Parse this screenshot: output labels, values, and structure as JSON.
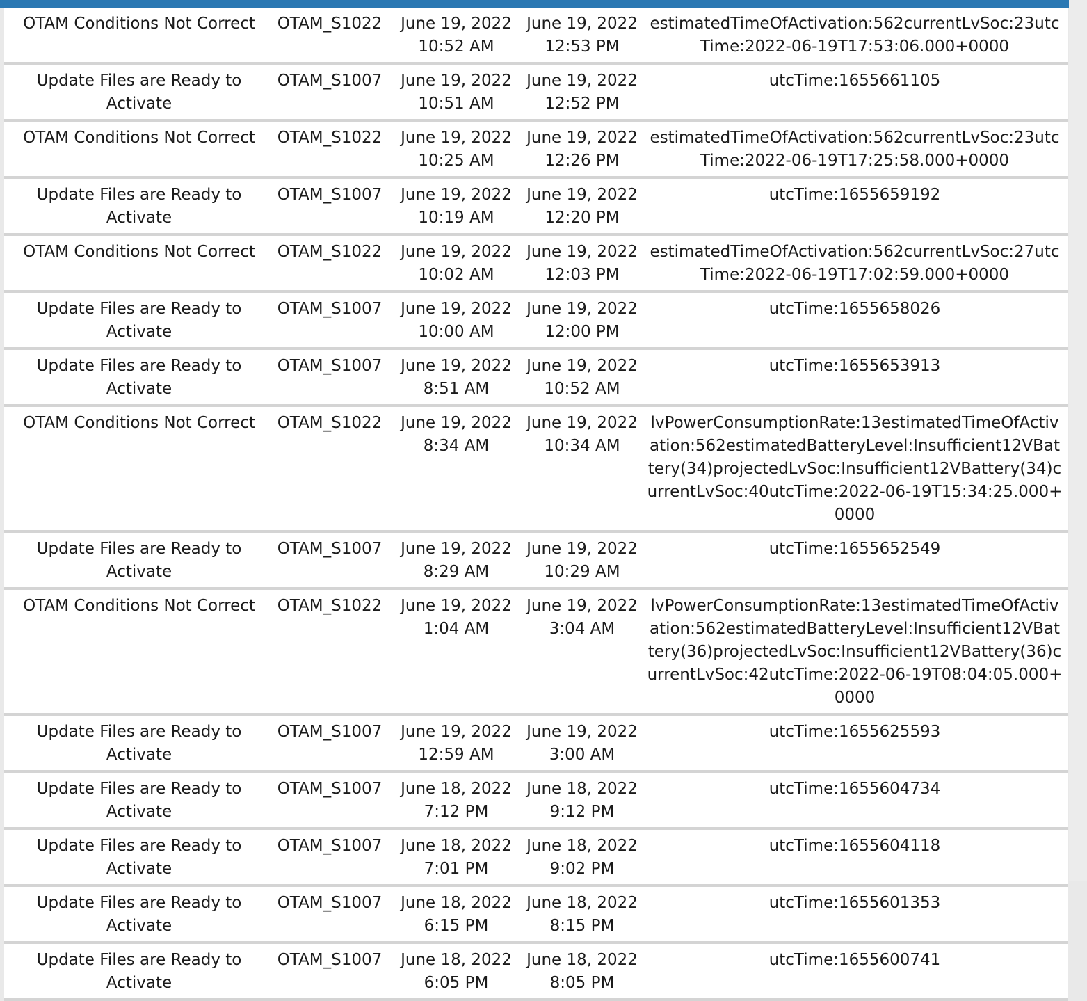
{
  "table": {
    "rows": [
      {
        "name": "OTAM Conditions Not Correct",
        "code": "OTAM_S1022",
        "start_date": "June 19, 2022",
        "start_time": "10:52 AM",
        "end_date": "June 19, 2022",
        "end_time": "12:53 PM",
        "data": "estimatedTimeOfActivation:562currentLvSoc:23utcTime:2022-06-19T17:53:06.000+0000"
      },
      {
        "name": "Update Files are Ready to Activate",
        "code": "OTAM_S1007",
        "start_date": "June 19, 2022",
        "start_time": "10:51 AM",
        "end_date": "June 19, 2022",
        "end_time": "12:52 PM",
        "data": "utcTime:1655661105"
      },
      {
        "name": "OTAM Conditions Not Correct",
        "code": "OTAM_S1022",
        "start_date": "June 19, 2022",
        "start_time": "10:25 AM",
        "end_date": "June 19, 2022",
        "end_time": "12:26 PM",
        "data": "estimatedTimeOfActivation:562currentLvSoc:23utcTime:2022-06-19T17:25:58.000+0000"
      },
      {
        "name": "Update Files are Ready to Activate",
        "code": "OTAM_S1007",
        "start_date": "June 19, 2022",
        "start_time": "10:19 AM",
        "end_date": "June 19, 2022",
        "end_time": "12:20 PM",
        "data": "utcTime:1655659192"
      },
      {
        "name": "OTAM Conditions Not Correct",
        "code": "OTAM_S1022",
        "start_date": "June 19, 2022",
        "start_time": "10:02 AM",
        "end_date": "June 19, 2022",
        "end_time": "12:03 PM",
        "data": "estimatedTimeOfActivation:562currentLvSoc:27utcTime:2022-06-19T17:02:59.000+0000"
      },
      {
        "name": "Update Files are Ready to Activate",
        "code": "OTAM_S1007",
        "start_date": "June 19, 2022",
        "start_time": "10:00 AM",
        "end_date": "June 19, 2022",
        "end_time": "12:00 PM",
        "data": "utcTime:1655658026"
      },
      {
        "name": "Update Files are Ready to Activate",
        "code": "OTAM_S1007",
        "start_date": "June 19, 2022",
        "start_time": "8:51 AM",
        "end_date": "June 19, 2022",
        "end_time": "10:52 AM",
        "data": "utcTime:1655653913"
      },
      {
        "name": "OTAM Conditions Not Correct",
        "code": "OTAM_S1022",
        "start_date": "June 19, 2022",
        "start_time": "8:34 AM",
        "end_date": "June 19, 2022",
        "end_time": "10:34 AM",
        "data": "lvPowerConsumptionRate:13estimatedTimeOfActivation:562estimatedBatteryLevel:Insufficient12VBattery(34)projectedLvSoc:Insufficient12VBattery(34)currentLvSoc:40utcTime:2022-06-19T15:34:25.000+0000"
      },
      {
        "name": "Update Files are Ready to Activate",
        "code": "OTAM_S1007",
        "start_date": "June 19, 2022",
        "start_time": "8:29 AM",
        "end_date": "June 19, 2022",
        "end_time": "10:29 AM",
        "data": "utcTime:1655652549"
      },
      {
        "name": "OTAM Conditions Not Correct",
        "code": "OTAM_S1022",
        "start_date": "June 19, 2022",
        "start_time": "1:04 AM",
        "end_date": "June 19, 2022",
        "end_time": "3:04 AM",
        "data": "lvPowerConsumptionRate:13estimatedTimeOfActivation:562estimatedBatteryLevel:Insufficient12VBattery(36)projectedLvSoc:Insufficient12VBattery(36)currentLvSoc:42utcTime:2022-06-19T08:04:05.000+0000"
      },
      {
        "name": "Update Files are Ready to Activate",
        "code": "OTAM_S1007",
        "start_date": "June 19, 2022",
        "start_time": "12:59 AM",
        "end_date": "June 19, 2022",
        "end_time": "3:00 AM",
        "data": "utcTime:1655625593"
      },
      {
        "name": "Update Files are Ready to Activate",
        "code": "OTAM_S1007",
        "start_date": "June 18, 2022",
        "start_time": "7:12 PM",
        "end_date": "June 18, 2022",
        "end_time": "9:12 PM",
        "data": "utcTime:1655604734"
      },
      {
        "name": "Update Files are Ready to Activate",
        "code": "OTAM_S1007",
        "start_date": "June 18, 2022",
        "start_time": "7:01 PM",
        "end_date": "June 18, 2022",
        "end_time": "9:02 PM",
        "data": "utcTime:1655604118"
      },
      {
        "name": "Update Files are Ready to Activate",
        "code": "OTAM_S1007",
        "start_date": "June 18, 2022",
        "start_time": "6:15 PM",
        "end_date": "June 18, 2022",
        "end_time": "8:15 PM",
        "data": "utcTime:1655601353"
      },
      {
        "name": "Update Files are Ready to Activate",
        "code": "OTAM_S1007",
        "start_date": "June 18, 2022",
        "start_time": "6:05 PM",
        "end_date": "June 18, 2022",
        "end_time": "8:05 PM",
        "data": "utcTime:1655600741"
      }
    ]
  }
}
